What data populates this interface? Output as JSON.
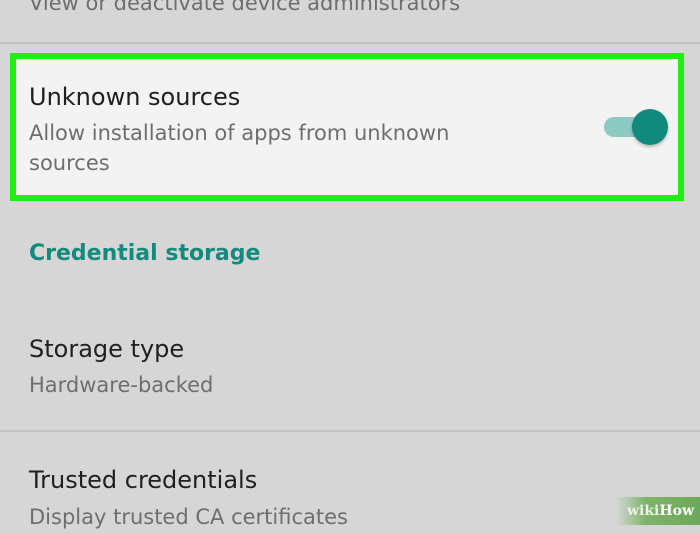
{
  "device_admins": {
    "subtitle": "View or deactivate device administrators"
  },
  "unknown_sources": {
    "title": "Unknown sources",
    "subtitle_line1": "Allow installation of apps from unknown",
    "subtitle_line2": "sources",
    "toggle_on": true
  },
  "credential_storage": {
    "header": "Credential storage",
    "storage_type": {
      "title": "Storage type",
      "subtitle": "Hardware-backed"
    },
    "trusted_credentials": {
      "title": "Trusted credentials",
      "subtitle": "Display trusted CA certificates"
    }
  },
  "watermark": {
    "wiki": "wiki",
    "how": "How"
  },
  "colors": {
    "accent": "#128a7c",
    "highlight_border": "#22ee11",
    "background": "#d6d6d6"
  }
}
